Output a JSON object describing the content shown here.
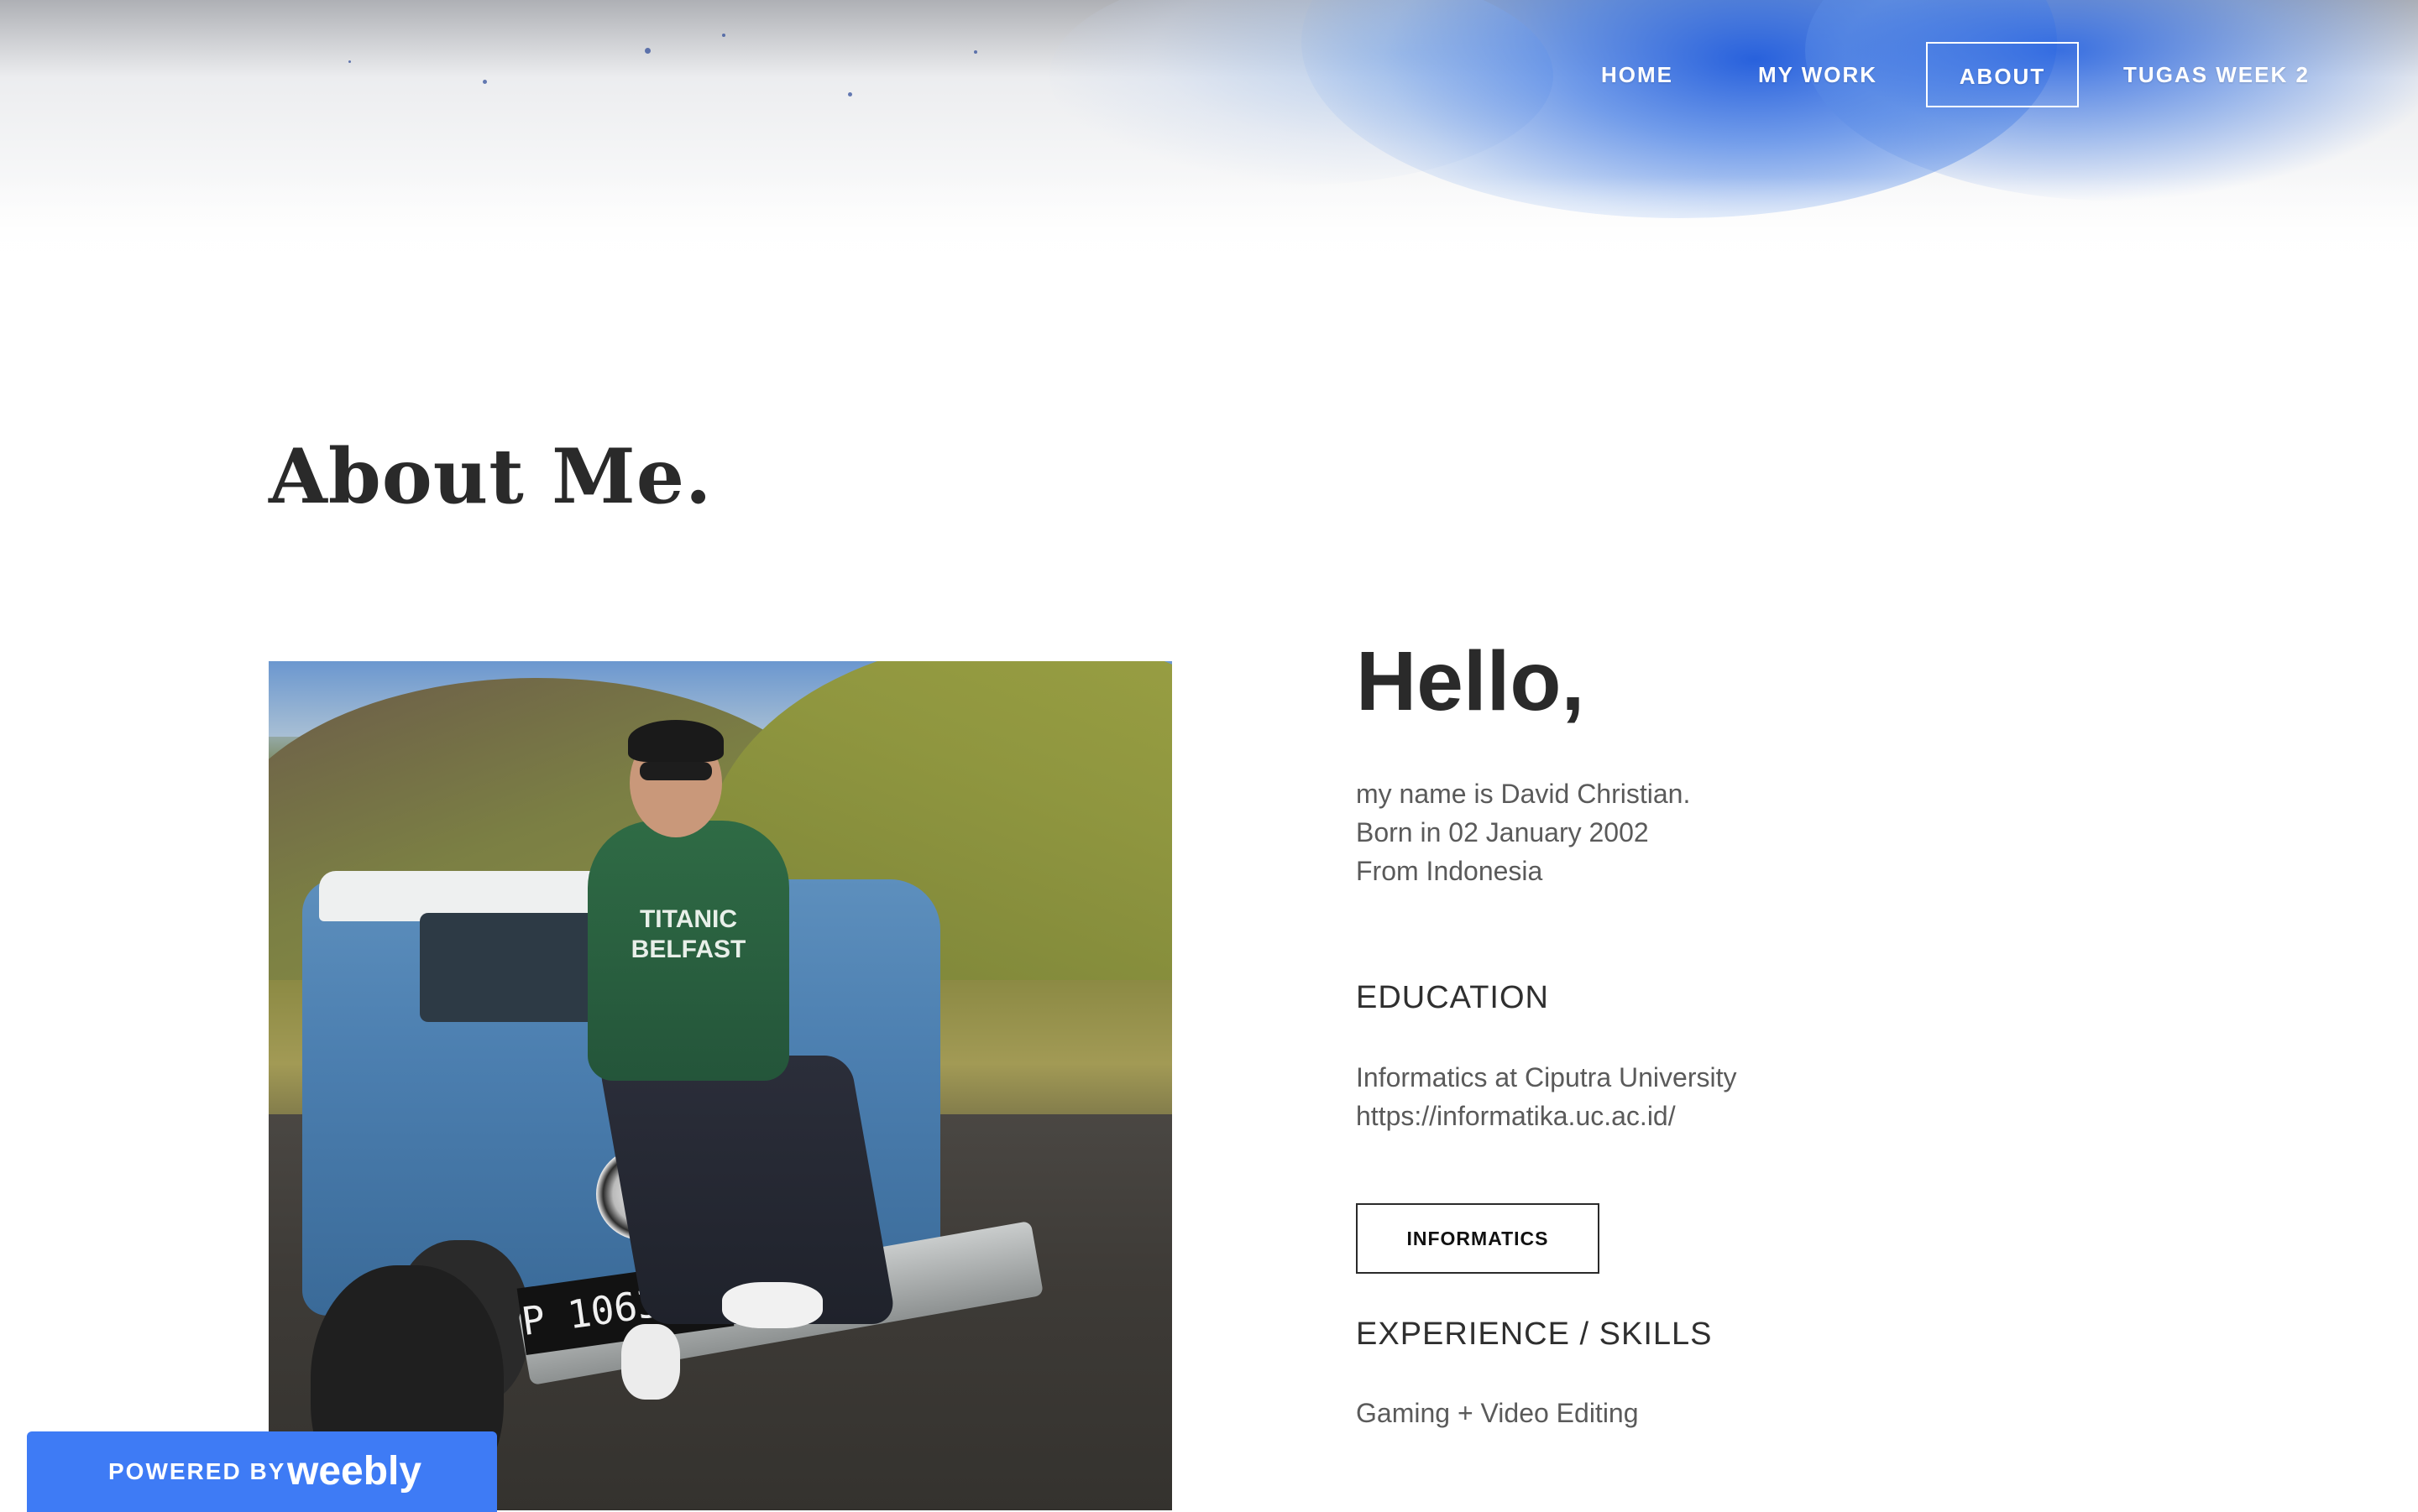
{
  "nav": {
    "items": [
      {
        "label": "HOME",
        "active": false
      },
      {
        "label": "MY WORK",
        "active": false
      },
      {
        "label": "ABOUT",
        "active": true
      },
      {
        "label": "TUGAS WEEK 2",
        "active": false
      }
    ]
  },
  "main": {
    "title": "About Me.",
    "photo": {
      "plate_text": "P 1063 GA",
      "hoodie_text": "TITANIC BELFAST"
    },
    "greeting": "Hello,",
    "intro_lines": [
      "my name is David Christian.",
      "Born in 02 January 2002",
      "From Indonesia"
    ],
    "education": {
      "heading": "EDUCATION",
      "lines": [
        "Informatics at Ciputra University",
        "https://informatika.uc.ac.id/"
      ],
      "button_label": "INFORMATICS"
    },
    "experience": {
      "heading": "EXPERIENCE / SKILLS",
      "text": "Gaming + Video Editing"
    }
  },
  "footer": {
    "powered_prefix": "POWERED BY",
    "powered_brand": "weebly"
  },
  "colors": {
    "accent_blue": "#3e7bf5",
    "text_dark": "#2a2a2a",
    "text_muted": "#5a5a5a"
  }
}
